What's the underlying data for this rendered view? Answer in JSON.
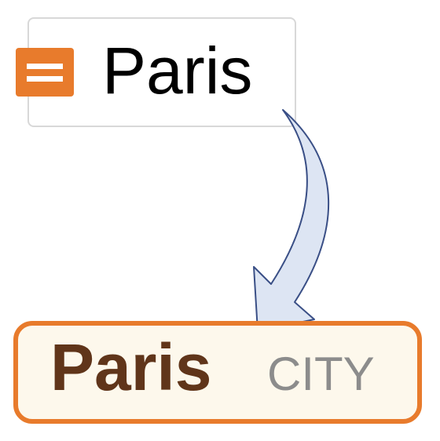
{
  "source": {
    "icon": "menu-lines-icon",
    "label": "Paris"
  },
  "result": {
    "name": "Paris",
    "type_tag": "CITY"
  },
  "colors": {
    "accent_orange": "#e87b2c",
    "result_fill": "#fdf8ec",
    "result_text": "#60351a",
    "type_text": "#8c8c8c",
    "arrow_fill": "#dde5f3",
    "arrow_stroke": "#3a4f86"
  }
}
